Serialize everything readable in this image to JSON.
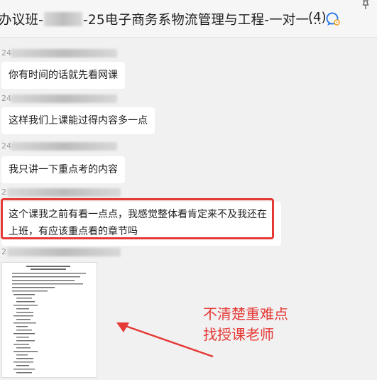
{
  "window": {
    "title_prefix": "办议班-",
    "title_suffix": "-25电子商务系物流管理与工程-一对一...",
    "member_count": "(4)"
  },
  "messages": [
    {
      "sender_prefix": "24",
      "text": "你有时间的话就先看网课"
    },
    {
      "sender_prefix": "24",
      "text": "这样我们上课能过得内容多一点"
    },
    {
      "sender_prefix": "24",
      "text": "我只讲一下重点考的内容"
    },
    {
      "sender_prefix": "2",
      "text": "这个课我之前有看一点点，我感觉整体看肯定来不及我还在上班，有应该重点看的章节吗"
    },
    {
      "sender_prefix": "2",
      "text": ""
    }
  ],
  "annotation": {
    "line1": "不清楚重难点",
    "line2": "找授课老师",
    "color": "#e53935"
  },
  "icons": {
    "chat": "chat-bubble-icon",
    "pin": "pin-icon"
  }
}
